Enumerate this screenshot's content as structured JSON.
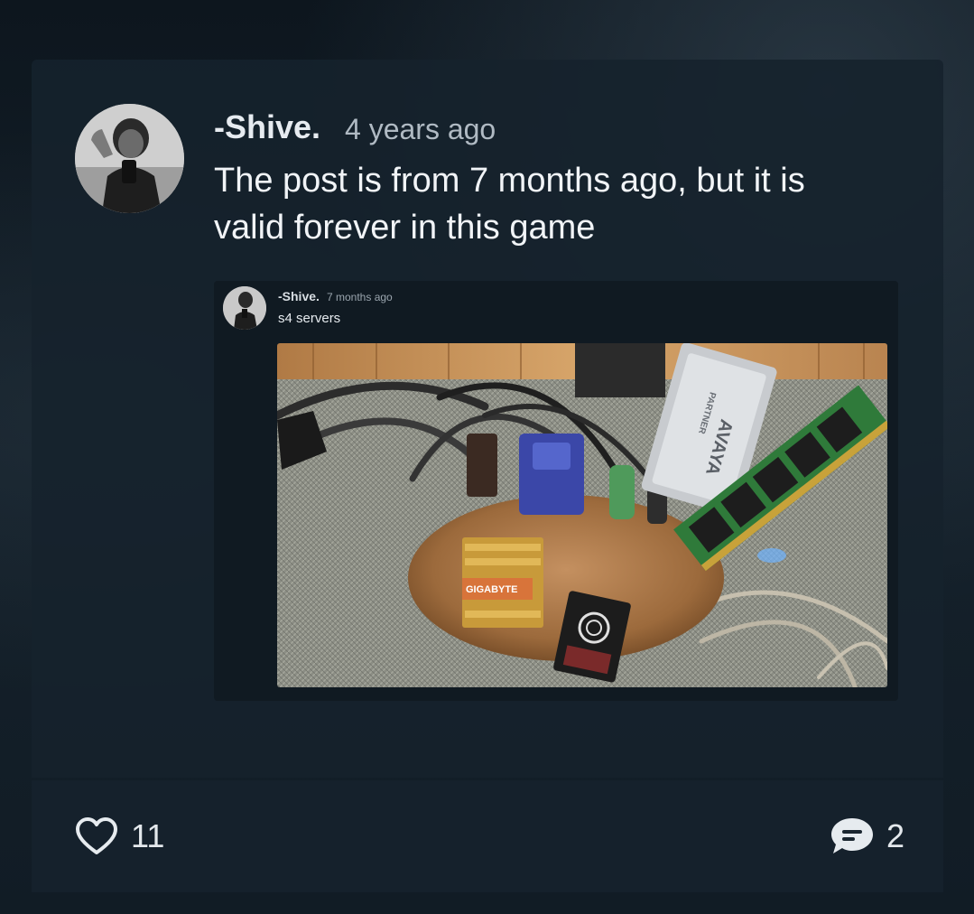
{
  "post": {
    "author": "-Shive.",
    "time": "4 years ago",
    "text": "The post is from 7 months ago, but it is valid forever in this game"
  },
  "embed": {
    "author": "-Shive.",
    "time": "7 months ago",
    "text": "s4 servers",
    "photo_labels": {
      "brand_ram": "AVAYA",
      "partner": "PARTNER",
      "gigabyte": "GIGABYTE"
    }
  },
  "footer": {
    "likes": "11",
    "comments": "2"
  },
  "icons": {
    "like": "heart-outline-icon",
    "comment": "speech-bubble-icon"
  },
  "colors": {
    "background": "#0f1922",
    "card": "#16222c",
    "text_primary": "#f1f4f7",
    "text_secondary": "#b0bac3"
  }
}
